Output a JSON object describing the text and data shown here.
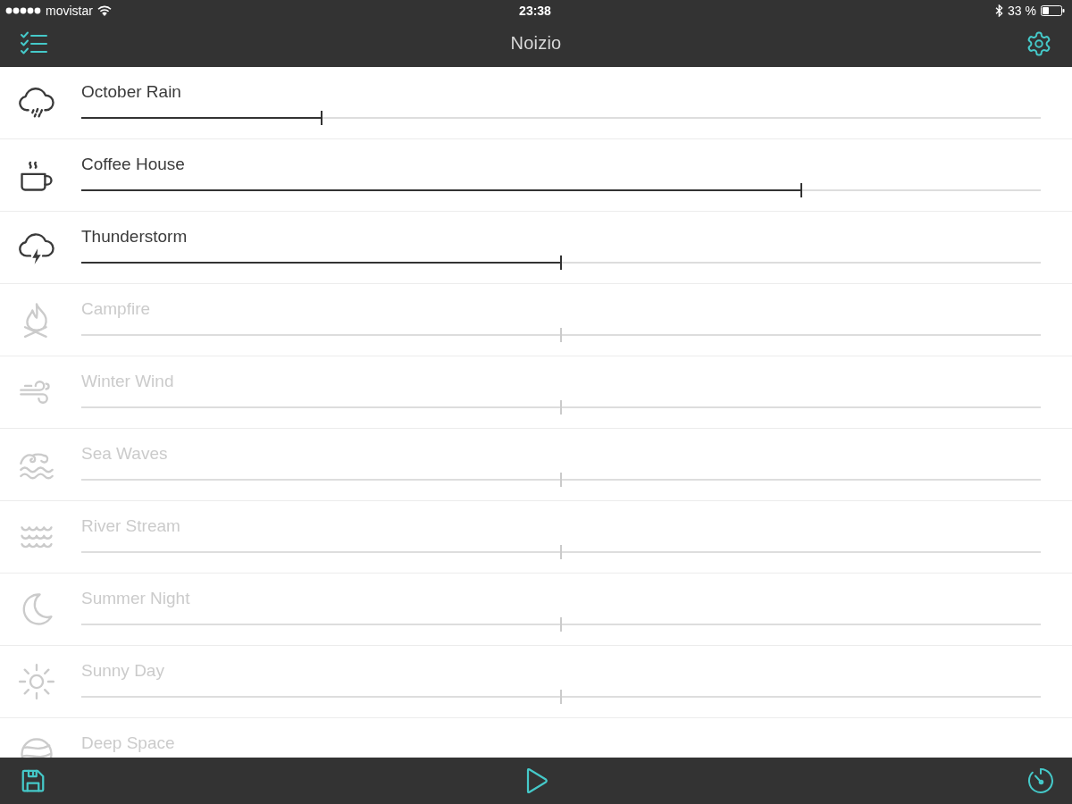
{
  "status_bar": {
    "carrier": "movistar",
    "time": "23:38",
    "battery": "33 %"
  },
  "nav_bar": {
    "title": "Noizio"
  },
  "sounds": [
    {
      "kind": "rain",
      "name": "October Rain",
      "active": true,
      "level": 0.25
    },
    {
      "kind": "coffee",
      "name": "Coffee House",
      "active": true,
      "level": 0.75
    },
    {
      "kind": "thunder",
      "name": "Thunderstorm",
      "active": true,
      "level": 0.5
    },
    {
      "kind": "fire",
      "name": "Campfire",
      "active": false,
      "level": 0.5
    },
    {
      "kind": "wind",
      "name": "Winter Wind",
      "active": false,
      "level": 0.5
    },
    {
      "kind": "waves",
      "name": "Sea Waves",
      "active": false,
      "level": 0.5
    },
    {
      "kind": "river",
      "name": "River Stream",
      "active": false,
      "level": 0.5
    },
    {
      "kind": "moon",
      "name": "Summer Night",
      "active": false,
      "level": 0.5
    },
    {
      "kind": "sun",
      "name": "Sunny Day",
      "active": false,
      "level": 0.5
    },
    {
      "kind": "planet",
      "name": "Deep Space",
      "active": false
    }
  ]
}
